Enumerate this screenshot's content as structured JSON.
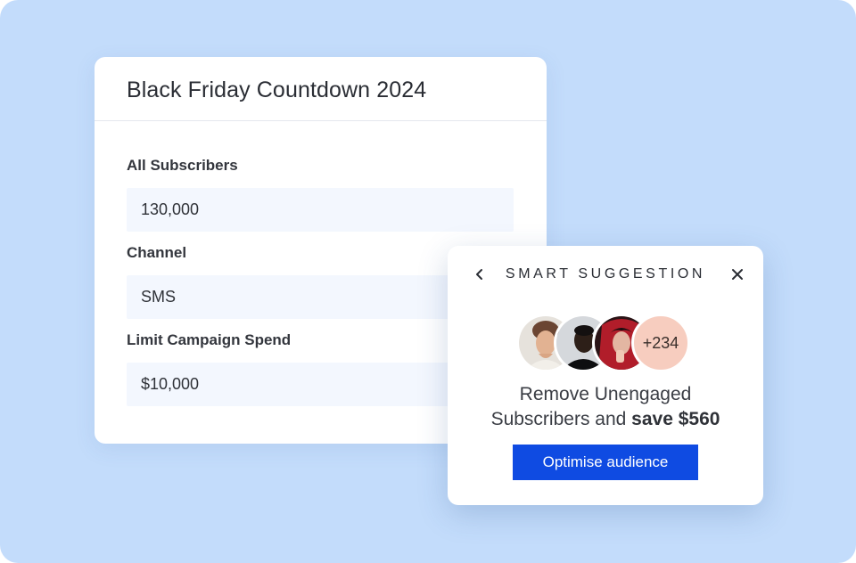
{
  "campaign": {
    "title": "Black Friday Countdown 2024",
    "fields": [
      {
        "label": "All Subscribers",
        "value": "130,000"
      },
      {
        "label": "Channel",
        "value": "SMS"
      },
      {
        "label": "Limit Campaign Spend",
        "value": "$10,000"
      }
    ]
  },
  "suggestion": {
    "title": "SMART SUGGESTION",
    "back_icon": "chevron-left-icon",
    "close_icon": "close-icon",
    "extra_count": "+234",
    "line1": "Remove Unengaged",
    "line2_prefix": "Subscribers and ",
    "line2_emphasis": "save $560",
    "button_label": "Optimise audience"
  },
  "colors": {
    "background": "#c3dcfb",
    "field_bg": "#f3f7fe",
    "button": "#0f4be2",
    "count_badge": "#f7cdbf"
  }
}
